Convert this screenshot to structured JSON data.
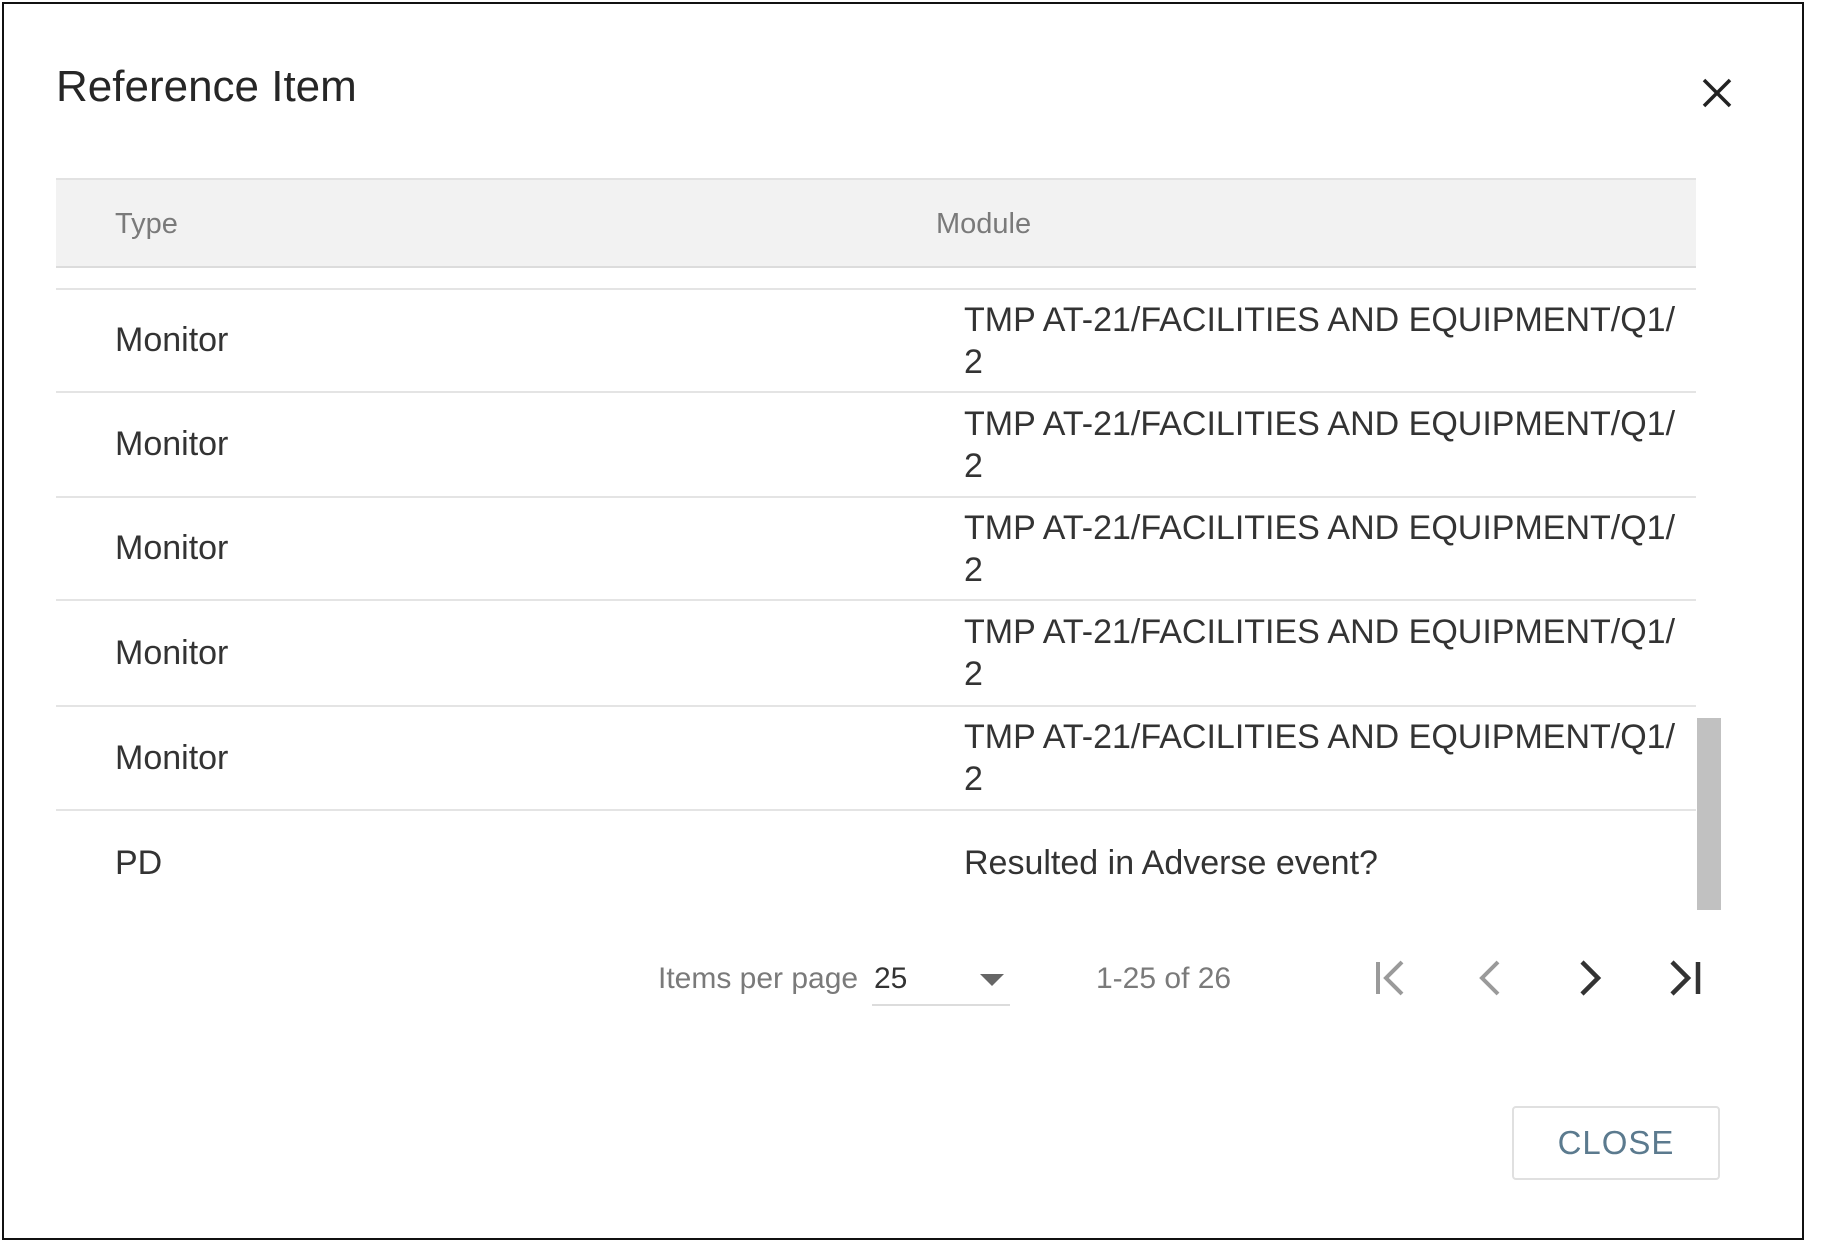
{
  "dialog": {
    "title": "Reference Item",
    "close_icon": "close-icon",
    "close_button_label": "CLOSE"
  },
  "table": {
    "columns": [
      "Type",
      "Module"
    ],
    "rows": [
      {
        "type": "",
        "module": "2"
      },
      {
        "type": "Monitor",
        "module": "TMP AT-21/FACILITIES AND EQUIPMENT/Q1/ 2"
      },
      {
        "type": "Monitor",
        "module": "TMP AT-21/FACILITIES AND EQUIPMENT/Q1/ 2"
      },
      {
        "type": "Monitor",
        "module": "TMP AT-21/FACILITIES AND EQUIPMENT/Q1/ 2"
      },
      {
        "type": "Monitor",
        "module": "TMP AT-21/FACILITIES AND EQUIPMENT/Q1/ 2"
      },
      {
        "type": "Monitor",
        "module": "TMP AT-21/FACILITIES AND EQUIPMENT/Q1/ 2"
      },
      {
        "type": "PD",
        "module": "Resulted in Adverse event?"
      }
    ]
  },
  "paginator": {
    "items_per_page_label": "Items per page",
    "items_per_page_value": "25",
    "range_label": "1-25 of 26",
    "icons": [
      "first-page-icon",
      "previous-page-icon",
      "next-page-icon",
      "last-page-icon"
    ]
  },
  "colors": {
    "header_bg": "#f2f2f2",
    "border": "#e4e4e4",
    "close_text": "#5b7a8e",
    "scrollbar": "#c1c1c1"
  }
}
